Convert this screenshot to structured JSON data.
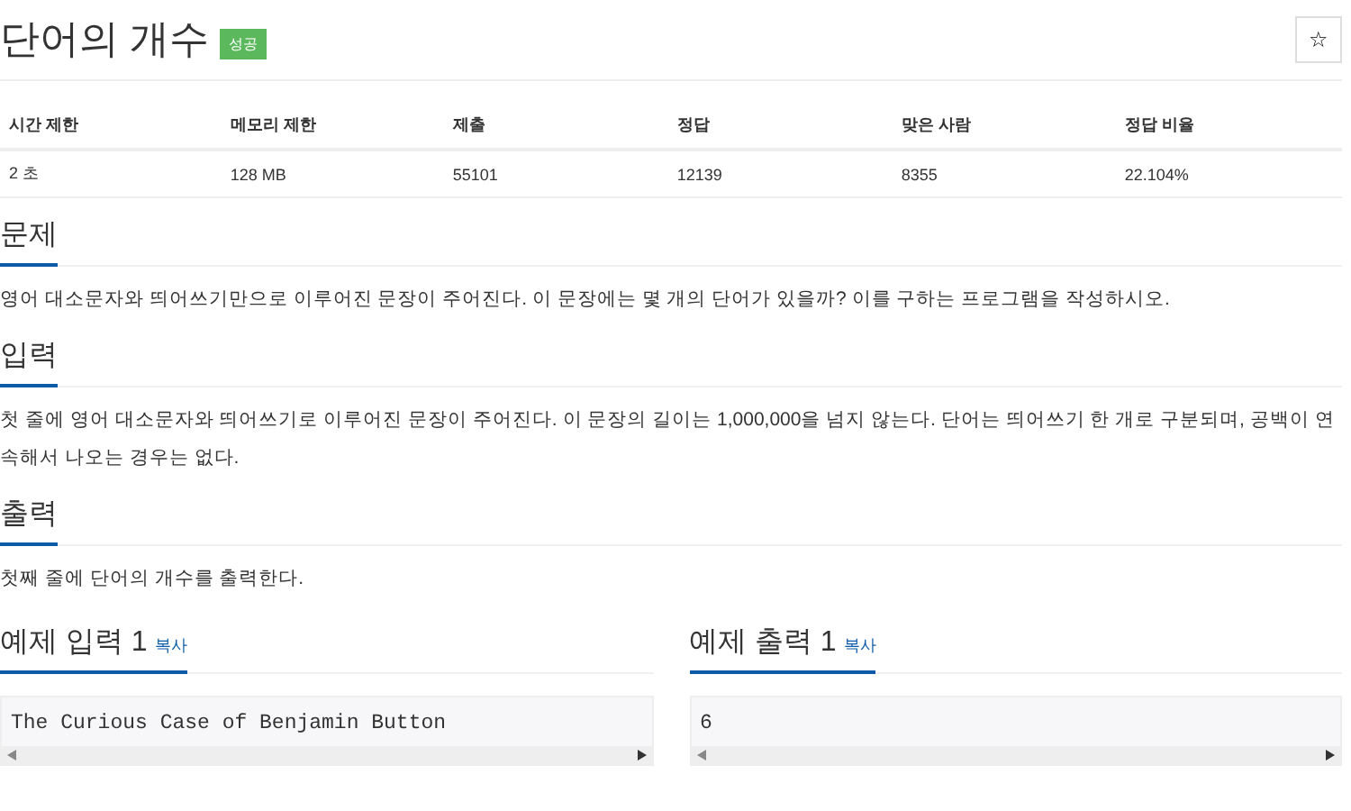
{
  "title": "단어의 개수",
  "badge": "성공",
  "star": "☆",
  "info": {
    "columns": [
      "시간 제한",
      "메모리 제한",
      "제출",
      "정답",
      "맞은 사람",
      "정답 비율"
    ],
    "values": [
      "2 초",
      "128 MB",
      "55101",
      "12139",
      "8355",
      "22.104%"
    ]
  },
  "sections": [
    {
      "heading": "문제",
      "paragraphs": [
        "영어 대소문자와 띄어쓰기만으로 이루어진 문장이 주어진다. 이 문장에는 몇 개의 단어가 있을까? 이를 구하는 프로그램을 작성하시오."
      ]
    },
    {
      "heading": "입력",
      "paragraphs": [
        "첫 줄에 영어 대소문자와 띄어쓰기로 이루어진 문장이 주어진다. 이 문장의 길이는 1,000,000을 넘지 않는다. 단어는 띄어쓰기 한 개로 구분되며, 공백이 연속해서 나오는 경우는 없다."
      ]
    },
    {
      "heading": "출력",
      "paragraphs": [
        "첫째 줄에 단어의 개수를 출력한다."
      ]
    }
  ],
  "samples": [
    {
      "heading": "예제 입력 1",
      "copy": "복사",
      "content": "The Curious Case of Benjamin Button"
    },
    {
      "heading": "예제 출력 1",
      "copy": "복사",
      "content": "6"
    }
  ]
}
